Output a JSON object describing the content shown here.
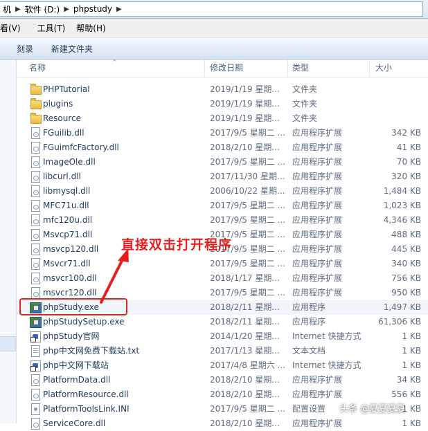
{
  "address": {
    "crumbs": [
      "机",
      "软件 (D:)",
      "phpstudy"
    ]
  },
  "menu": {
    "items": [
      "看(V)",
      "工具(T)",
      "帮助(H)"
    ]
  },
  "toolbar": {
    "burn_label": "刻录",
    "new_folder_label": "新建文件夹"
  },
  "columns": {
    "name": "名称",
    "date": "修改日期",
    "type": "类型",
    "size": "大小"
  },
  "files": [
    {
      "icon": "folder",
      "name": "PHPTutorial",
      "date": "2019/1/19 星期...",
      "type": "文件夹",
      "size": ""
    },
    {
      "icon": "folder",
      "name": "plugins",
      "date": "2019/1/19 星期...",
      "type": "文件夹",
      "size": ""
    },
    {
      "icon": "folder",
      "name": "Resource",
      "date": "2019/1/19 星期...",
      "type": "文件夹",
      "size": ""
    },
    {
      "icon": "dll",
      "name": "FGuilib.dll",
      "date": "2017/9/5 星期二 ...",
      "type": "应用程序扩展",
      "size": "342 KB"
    },
    {
      "icon": "dll",
      "name": "FGuimfcFactory.dll",
      "date": "2018/2/10 星期...",
      "type": "应用程序扩展",
      "size": "41 KB"
    },
    {
      "icon": "dll",
      "name": "ImageOle.dll",
      "date": "2017/9/5 星期二 ...",
      "type": "应用程序扩展",
      "size": "70 KB"
    },
    {
      "icon": "dll",
      "name": "libcurl.dll",
      "date": "2017/11/30 星期...",
      "type": "应用程序扩展",
      "size": "320 KB"
    },
    {
      "icon": "dll",
      "name": "libmysql.dll",
      "date": "2006/10/22 星期...",
      "type": "应用程序扩展",
      "size": "1,484 KB"
    },
    {
      "icon": "dll",
      "name": "MFC71u.dll",
      "date": "2017/9/5 星期二 ...",
      "type": "应用程序扩展",
      "size": "1,023 KB"
    },
    {
      "icon": "dll",
      "name": "mfc120u.dll",
      "date": "2017/9/5 星期二 ...",
      "type": "应用程序扩展",
      "size": "4,346 KB"
    },
    {
      "icon": "dll",
      "name": "Msvcp71.dll",
      "date": "2017/9/5 星期二 ...",
      "type": "应用程序扩展",
      "size": "488 KB"
    },
    {
      "icon": "dll",
      "name": "msvcp120.dll",
      "date": "2017/9/5 星期二 ...",
      "type": "应用程序扩展",
      "size": "445 KB"
    },
    {
      "icon": "dll",
      "name": "Msvcr71.dll",
      "date": "2017/9/5 星期二 ...",
      "type": "应用程序扩展",
      "size": "340 KB"
    },
    {
      "icon": "dll",
      "name": "msvcr100.dll",
      "date": "2018/1/17 星期...",
      "type": "应用程序扩展",
      "size": "756 KB"
    },
    {
      "icon": "dll",
      "name": "msvcr120.dll",
      "date": "2017/9/5 星期二 ...",
      "type": "应用程序扩展",
      "size": "950 KB"
    },
    {
      "icon": "exe",
      "name": "phpStudy.exe",
      "date": "2018/2/11 星期...",
      "type": "应用程序",
      "size": "1,497 KB",
      "selected": true
    },
    {
      "icon": "exe",
      "name": "phpStudySetup.exe",
      "date": "2018/2/11 星期...",
      "type": "应用程序",
      "size": "61,306 KB"
    },
    {
      "icon": "link",
      "name": "phpStudy官网",
      "date": "2014/1/20 星期...",
      "type": "Internet 快捷方式",
      "size": "1 KB"
    },
    {
      "icon": "txt",
      "name": "php中文网免费下载站.txt",
      "date": "2017/1/13 星期...",
      "type": "文本文档",
      "size": "1 KB"
    },
    {
      "icon": "link",
      "name": "php中文网下载站",
      "date": "2017/4/8 星期六 ...",
      "type": "Internet 快捷方式",
      "size": "1 KB"
    },
    {
      "icon": "dll",
      "name": "PlatformData.dll",
      "date": "2018/2/10 星期...",
      "type": "应用程序扩展",
      "size": "34 KB"
    },
    {
      "icon": "dll",
      "name": "PlatformResource.dll",
      "date": "2018/2/10 星期...",
      "type": "应用程序扩展",
      "size": "556 KB"
    },
    {
      "icon": "ini",
      "name": "PlatformToolsLink.INI",
      "date": "2017/9/5 星期二 ...",
      "type": "配置设置",
      "size": "1 KB"
    },
    {
      "icon": "dll",
      "name": "ServiceCore.dll",
      "date": "2018/2/10 星期...",
      "type": "应用程序扩展",
      "size": "1 KB"
    }
  ],
  "annotation": {
    "text": "直接双击打开程序",
    "color": "#e81e1e"
  },
  "watermark": "头条 @夏夏夏夏"
}
